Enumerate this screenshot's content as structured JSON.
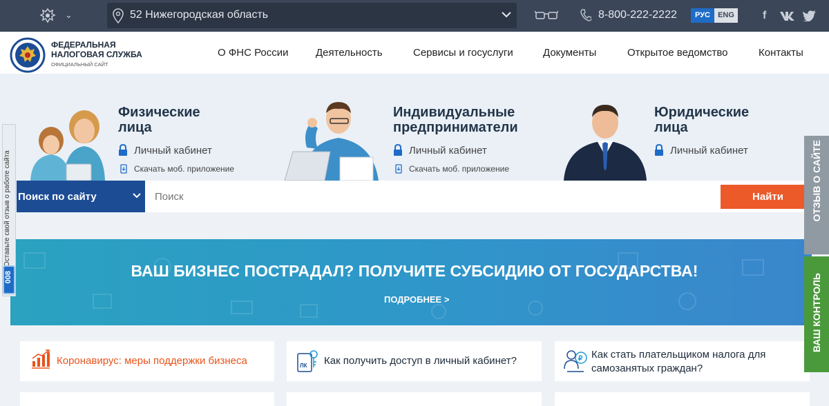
{
  "topbar": {
    "region": "52 Нижегородская область",
    "phone": "8-800-222-2222",
    "lang_ru": "РУС",
    "lang_en": "ENG",
    "social": [
      "f",
      "vk",
      "tw"
    ]
  },
  "header": {
    "logo_line1": "ФЕДЕРАЛЬНАЯ",
    "logo_line2": "НАЛОГОВАЯ СЛУЖБА",
    "logo_sub": "ОФИЦИАЛЬНЫЙ САЙТ",
    "nav": [
      "О ФНС России",
      "Деятельность",
      "Сервисы и госуслуги",
      "Документы",
      "Открытое ведомство",
      "Контакты"
    ]
  },
  "hero": {
    "segments": [
      {
        "title_line1": "Физические",
        "title_line2": "лица",
        "cabinet": "Личный кабинет",
        "app": "Скачать моб. приложение"
      },
      {
        "title_line1": "Индивидуальные",
        "title_line2": "предприниматели",
        "cabinet": "Личный кабинет",
        "app": "Скачать моб. приложение"
      },
      {
        "title_line1": "Юридические",
        "title_line2": "лица",
        "cabinet": "Личный кабинет"
      }
    ]
  },
  "search": {
    "scope": "Поиск по сайту",
    "placeholder": "Поиск",
    "button": "Найти"
  },
  "banner": {
    "title": "ВАШ БИЗНЕС ПОСТРАДАЛ? ПОЛУЧИТЕ СУБСИДИЮ ОТ ГОСУДАРСТВА!",
    "link": "ПОДРОБНЕЕ >"
  },
  "cards": [
    {
      "text": "Коронавирус: меры поддержки бизнеса",
      "icon": "chart-growth-icon",
      "color": "#e8541c"
    },
    {
      "text": "Как получить доступ в личный кабинет?",
      "icon": "cabinet-key-icon",
      "color": "#1c2a3a"
    },
    {
      "text_line1": "Как стать плательщиком налога для",
      "text_line2": "самозанятых граждан?",
      "icon": "self-employed-icon",
      "color": "#1c2a3a"
    }
  ],
  "side": {
    "feedback": "Оставьте свой отзыв о работе сайта",
    "feedback_badge": "008",
    "right_top": "ОТЗЫВ О САЙТЕ",
    "right_bottom": "ВАШ КОНТРОЛЬ"
  },
  "colors": {
    "topbar": "#3b4658",
    "accent_blue": "#1c4c94",
    "search_button": "#ed5a29",
    "control_green": "#4a9a3c"
  }
}
